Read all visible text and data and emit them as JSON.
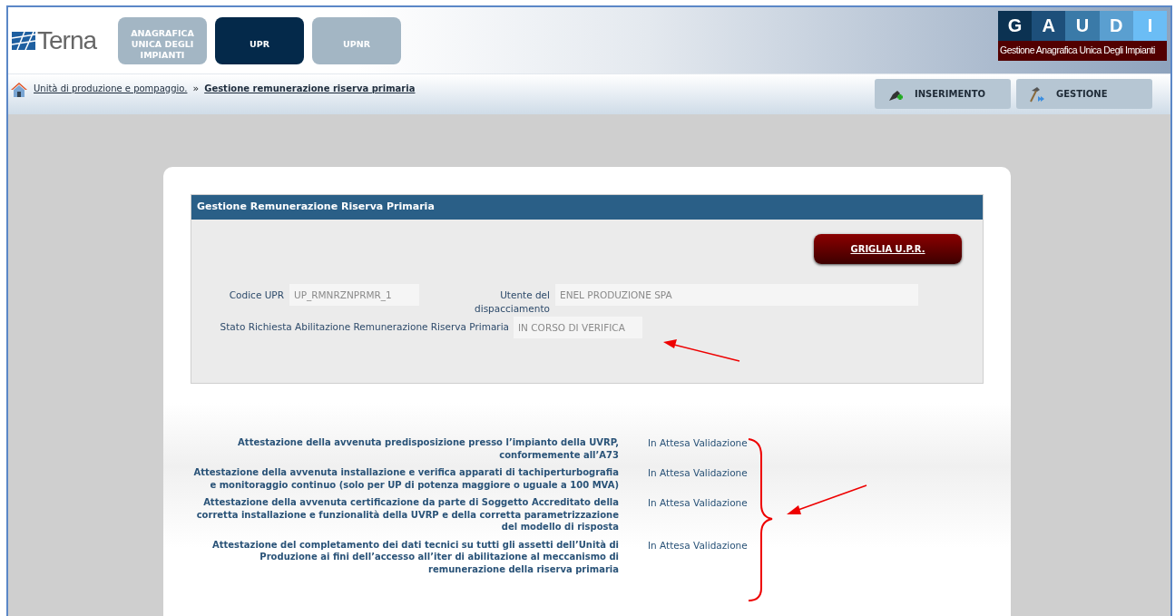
{
  "header": {
    "logo": "Terna",
    "tabs": [
      {
        "label": "ANAGRAFICA UNICA DEGLI IMPIANTI",
        "selected": false
      },
      {
        "label": "UPR",
        "selected": true
      },
      {
        "label": "UPNR",
        "selected": false
      }
    ],
    "brand_letters": [
      "G",
      "A",
      "U",
      "D",
      "I"
    ],
    "brand_subtitle": "Gestione Anagrafica Unica Degli Impianti"
  },
  "breadcrumb": {
    "items": [
      "Unità di produzione e pompaggio.",
      "Gestione remunerazione riserva primaria"
    ],
    "separator": "»"
  },
  "actions": [
    {
      "label": "INSERIMENTO",
      "kind": "plug"
    },
    {
      "label": "GESTIONE",
      "kind": "hammer"
    }
  ],
  "panel": {
    "title": "Gestione Remunerazione Riserva Primaria",
    "button": "GRIGLIA U.P.R.",
    "fields": [
      {
        "label": "Codice UPR",
        "value": "UP_RMNRZNPRMR_1"
      },
      {
        "label": "Utente del dispacciamento",
        "value": "ENEL PRODUZIONE SPA"
      },
      {
        "label": "Stato Richiesta Abilitazione Remunerazione Riserva Primaria",
        "value": "IN CORSO DI VERIFICA"
      }
    ]
  },
  "attestations": [
    {
      "label": "Attestazione della avvenuta predisposizione presso l’impianto della UVRP, conformemente all’A73",
      "status": "In Attesa Validazione"
    },
    {
      "label": "Attestazione della avvenuta installazione e verifica apparati di tachiperturbografia e monitoraggio continuo (solo per UP di potenza maggiore o uguale a 100 MVA)",
      "status": "In Attesa Validazione"
    },
    {
      "label": "Attestazione della avvenuta certificazione da parte di Soggetto Accreditato della corretta installazione e funzionalità della UVRP e della corretta parametrizzazione del modello di risposta",
      "status": "In Attesa Validazione"
    },
    {
      "label": "Attestazione del completamento dei dati tecnici su tutti gli assetti dell’Unità di Produzione ai fini dell’accesso all’iter di abilitazione al meccanismo di remunerazione della riserva primaria",
      "status": "In Attesa Validazione"
    }
  ]
}
